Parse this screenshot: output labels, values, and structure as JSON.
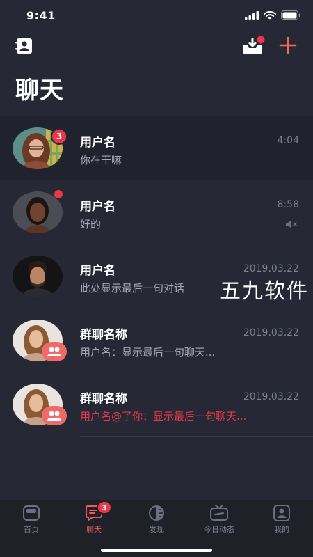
{
  "status_bar": {
    "time": "9:41"
  },
  "header": {
    "title": "聊天",
    "left_icon": "contacts-book-icon",
    "right_icons": [
      "inbox-download-icon",
      "plus-icon"
    ]
  },
  "chats": [
    {
      "name": "用户名",
      "time": "4:04",
      "message": "你在干嘛",
      "unread": "3",
      "type": "single"
    },
    {
      "name": "用户名",
      "time": "8:58",
      "message": "好的",
      "dot": true,
      "muted": true,
      "type": "single"
    },
    {
      "name": "用户名",
      "time": "2019.03.22",
      "message": "此处显示最后一句对话",
      "type": "single"
    },
    {
      "name": "群聊名称",
      "time": "2019.03.22",
      "message": "用户名：显示最后一句聊天...",
      "type": "group"
    },
    {
      "name": "群聊名称",
      "time": "2019.03.22",
      "message": "用户名@了你：显示最后一句聊天...",
      "type": "group",
      "mention": true
    }
  ],
  "watermark": "五九软件",
  "tabbar": {
    "tabs": [
      {
        "label": "首页",
        "icon": "home-icon"
      },
      {
        "label": "聊天",
        "icon": "chat-icon",
        "active": true,
        "badge": "3"
      },
      {
        "label": "发现",
        "icon": "discover-icon"
      },
      {
        "label": "今日动态",
        "icon": "tv-icon"
      },
      {
        "label": "我的",
        "icon": "profile-icon"
      }
    ]
  },
  "colors": {
    "background": "#262935",
    "accent": "#e8394b",
    "muted_text": "#7c8091"
  }
}
